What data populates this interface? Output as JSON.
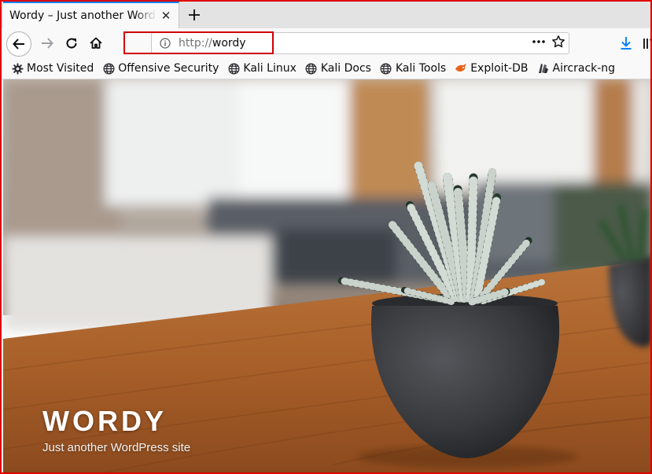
{
  "browser": {
    "tab": {
      "title": "Wordy – Just another WordPress site"
    },
    "url": {
      "scheme": "http://",
      "host": "wordy"
    }
  },
  "bookmarks": [
    {
      "label": "Most Visited",
      "icon": "gear-icon"
    },
    {
      "label": "Offensive Security",
      "icon": "globe-icon"
    },
    {
      "label": "Kali Linux",
      "icon": "globe-icon"
    },
    {
      "label": "Kali Docs",
      "icon": "globe-icon"
    },
    {
      "label": "Kali Tools",
      "icon": "globe-icon"
    },
    {
      "label": "Exploit-DB",
      "icon": "exploit-db-icon"
    },
    {
      "label": "Aircrack-ng",
      "icon": "aircrack-icon"
    }
  ],
  "site": {
    "title": "WORDY",
    "tagline": "Just another WordPress site"
  },
  "colors": {
    "accent": "#0a84ff",
    "highlight": "#d00000",
    "frame": "#e00000"
  }
}
